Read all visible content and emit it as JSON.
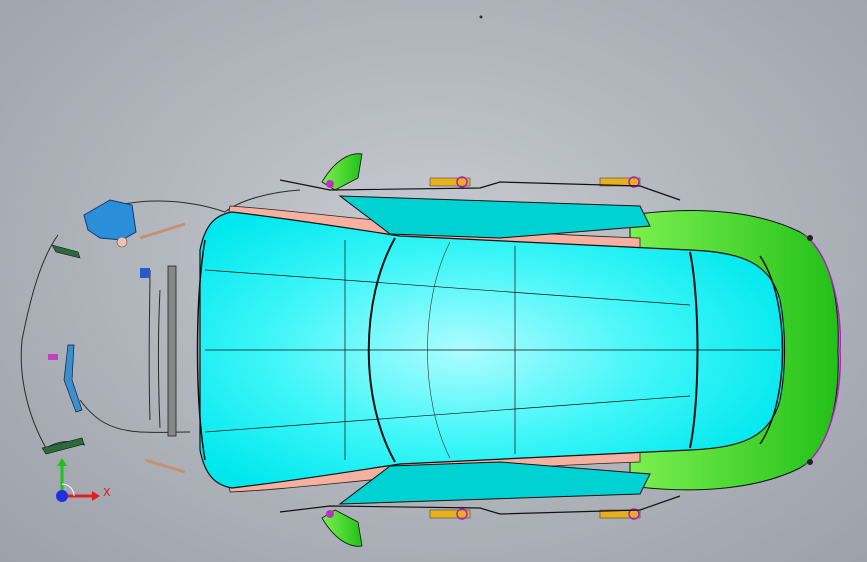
{
  "viewport": {
    "background_top": "#c9ccd2",
    "background_bottom": "#9ca1aa"
  },
  "model": {
    "body_color": "#00ffff",
    "front_panel_color": "#33dd22",
    "trim_color": "#f5b0a0",
    "window_color": "#00d0d0",
    "edge_color": "#111111"
  },
  "triad": {
    "x_label": "X",
    "x_color": "#e02020",
    "y_color": "#20c020",
    "z_color": "#2030e0"
  }
}
